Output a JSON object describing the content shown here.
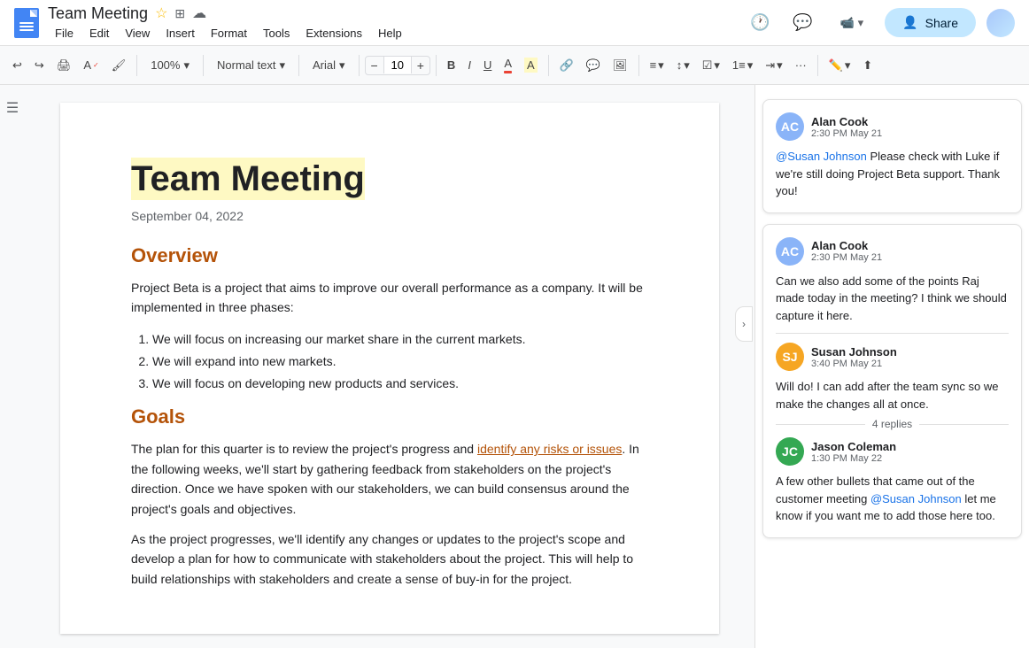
{
  "title_bar": {
    "doc_title": "Team Meeting",
    "menu": {
      "file": "File",
      "edit": "Edit",
      "view": "View",
      "insert": "Insert",
      "format": "Format",
      "tools": "Tools",
      "extensions": "Extensions",
      "help": "Help"
    },
    "share_label": "Share"
  },
  "toolbar": {
    "undo_label": "↩",
    "redo_label": "↪",
    "print_label": "🖨",
    "paint_format_label": "🖌",
    "zoom_label": "100%",
    "zoom_arrow": "▾",
    "style_label": "Normal text",
    "style_arrow": "▾",
    "font_label": "Arial",
    "font_arrow": "▾",
    "font_size": "10",
    "bold_label": "B",
    "italic_label": "I",
    "underline_label": "U",
    "more_label": "···"
  },
  "document": {
    "title": "Team Meeting",
    "date": "September 04, 2022",
    "overview_heading": "Overview",
    "overview_text": "Project Beta is a project that aims to improve our overall performance as a company. It will be implemented in three phases:",
    "bullet_1": "We will focus on increasing our market share in the current markets.",
    "bullet_2": "We will expand into new markets.",
    "bullet_3": "We will focus on developing new products and services.",
    "goals_heading": "Goals",
    "goals_text_1_before": "The plan for this quarter is to review the project's progress and ",
    "goals_highlight": "identify any risks or issues",
    "goals_text_1_after": ". In the following weeks, we'll start by gathering feedback from stakeholders on the project's direction. Once we have spoken with our stakeholders, we can build consensus around the project's goals and objectives.",
    "goals_text_2": "As the project progresses, we'll identify any changes or updates to the project's scope and develop a plan for how to communicate with stakeholders about the project. This will help to build relationships with stakeholders and create a sense of buy-in for the project."
  },
  "comments": [
    {
      "id": "comment1",
      "author": "Alan Cook",
      "avatar_initials": "AC",
      "time": "2:30 PM May 21",
      "mention": "@Susan Johnson",
      "text_before": "",
      "text": " Please check with Luke if we're still doing Project Beta support. Thank you!",
      "has_divider": false
    },
    {
      "id": "comment2",
      "author": "Alan Cook",
      "avatar_initials": "AC",
      "time": "2:30 PM May 21",
      "text": "Can we also add some of the points Raj made today in the meeting? I think we should capture it here.",
      "reply_author": "Susan Johnson",
      "reply_avatar_initials": "SJ",
      "reply_time": "3:40 PM May 21",
      "reply_text": "Will do! I can add after the team sync so we make the changes all at once.",
      "replies_count": "4 replies",
      "thread_author": "Jason Coleman",
      "thread_avatar_initials": "JC",
      "thread_time": "1:30 PM May 22",
      "thread_mention": "@Susan Johnson",
      "thread_text_before": "A few other bullets that came out of the customer meeting ",
      "thread_text_after": " let me know if you want me to add those here too."
    }
  ]
}
